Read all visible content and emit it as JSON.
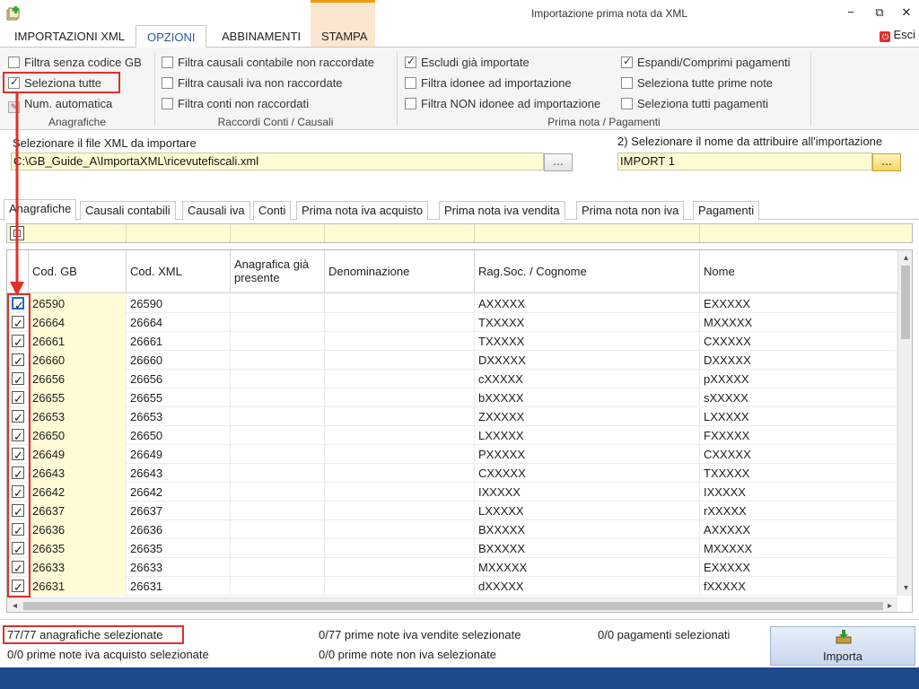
{
  "window": {
    "title": "Importazione prima nota da XML",
    "controls": [
      "−",
      "⧉",
      "✕"
    ]
  },
  "ribbon": {
    "tabs": [
      "IMPORTAZIONI XML",
      "OPZIONI",
      "ABBINAMENTI",
      "STAMPA"
    ],
    "exit_label": "Esci",
    "groups": {
      "anagrafiche": {
        "label": "Anagrafiche",
        "filtra_senza_codice": "Filtra senza codice GB",
        "seleziona_tutte": "Seleziona tutte",
        "num_automatica": "Num. automatica"
      },
      "raccordi": {
        "label": "Raccordi Conti / Causali",
        "causali_contabile": "Filtra causali contabile non raccordate",
        "causali_iva": "Filtra causali iva non raccordate",
        "conti": "Filtra conti non raccordati"
      },
      "prima_nota": {
        "label": "Prima nota / Pagamenti",
        "escludi_importate": "Escludi già importate",
        "filtra_idonee": "Filtra idonee ad importazione",
        "filtra_non_idonee": "Filtra NON idonee ad importazione",
        "espandi": "Espandi/Comprimi pagamenti",
        "seleziona_prime_note": "Seleziona tutte prime note",
        "seleziona_pagamenti": "Seleziona tutti pagamenti"
      }
    }
  },
  "file_section": {
    "xml_label": "Selezionare il file XML da importare",
    "xml_path": "C:\\GB_Guide_A\\ImportaXML\\ricevutefiscali.xml",
    "name_label": "2) Selezionare il nome da attribuire all'importazione",
    "import_name": "IMPORT 1",
    "browse_label": "..."
  },
  "data_tabs": [
    "Anagrafiche",
    "Causali contabili",
    "Causali iva",
    "Conti",
    "Prima nota iva acquisto",
    "Prima nota iva vendita",
    "Prima nota non iva",
    "Pagamenti"
  ],
  "grid": {
    "headers": [
      "Cod. GB",
      "Cod. XML",
      "Anagrafica già presente",
      "Denominazione",
      "Rag.Soc. / Cognome",
      "Nome"
    ],
    "rows": [
      {
        "gb": "26590",
        "xml": "26590",
        "ragsoc": "AXXXXX",
        "nome": "EXXXXX"
      },
      {
        "gb": "26664",
        "xml": "26664",
        "ragsoc": "TXXXXX",
        "nome": "MXXXXX"
      },
      {
        "gb": "26661",
        "xml": "26661",
        "ragsoc": "TXXXXX",
        "nome": "CXXXXX"
      },
      {
        "gb": "26660",
        "xml": "26660",
        "ragsoc": "DXXXXX",
        "nome": "DXXXXX"
      },
      {
        "gb": "26656",
        "xml": "26656",
        "ragsoc": "cXXXXX",
        "nome": "pXXXXX"
      },
      {
        "gb": "26655",
        "xml": "26655",
        "ragsoc": "bXXXXX",
        "nome": "sXXXXX"
      },
      {
        "gb": "26653",
        "xml": "26653",
        "ragsoc": "ZXXXXX",
        "nome": "LXXXXX"
      },
      {
        "gb": "26650",
        "xml": "26650",
        "ragsoc": "LXXXXX",
        "nome": "FXXXXX"
      },
      {
        "gb": "26649",
        "xml": "26649",
        "ragsoc": "PXXXXX",
        "nome": "CXXXXX"
      },
      {
        "gb": "26643",
        "xml": "26643",
        "ragsoc": "CXXXXX",
        "nome": "TXXXXX"
      },
      {
        "gb": "26642",
        "xml": "26642",
        "ragsoc": "IXXXXX",
        "nome": "IXXXXX"
      },
      {
        "gb": "26637",
        "xml": "26637",
        "ragsoc": "LXXXXX",
        "nome": "rXXXXX"
      },
      {
        "gb": "26636",
        "xml": "26636",
        "ragsoc": "BXXXXX",
        "nome": "AXXXXX"
      },
      {
        "gb": "26635",
        "xml": "26635",
        "ragsoc": "BXXXXX",
        "nome": "MXXXXX"
      },
      {
        "gb": "26633",
        "xml": "26633",
        "ragsoc": "MXXXXX",
        "nome": "EXXXXX"
      },
      {
        "gb": "26631",
        "xml": "26631",
        "ragsoc": "dXXXXX",
        "nome": "fXXXXX"
      }
    ]
  },
  "status": {
    "anagrafiche": "77/77 anagrafiche selezionate",
    "iva_acquisto": "0/0 prime note iva acquisto selezionate",
    "iva_vendite": "0/77 prime note iva vendite selezionate",
    "non_iva": "0/0 prime note non iva selezionate",
    "pagamenti": "0/0 pagamenti selezionati",
    "import_button": "Importa"
  },
  "colors": {
    "annotation_red": "#e0302a",
    "input_yellow": "#fffbd3",
    "accent_blue": "#2b579a",
    "bottom_bar": "#1c4a8c"
  }
}
